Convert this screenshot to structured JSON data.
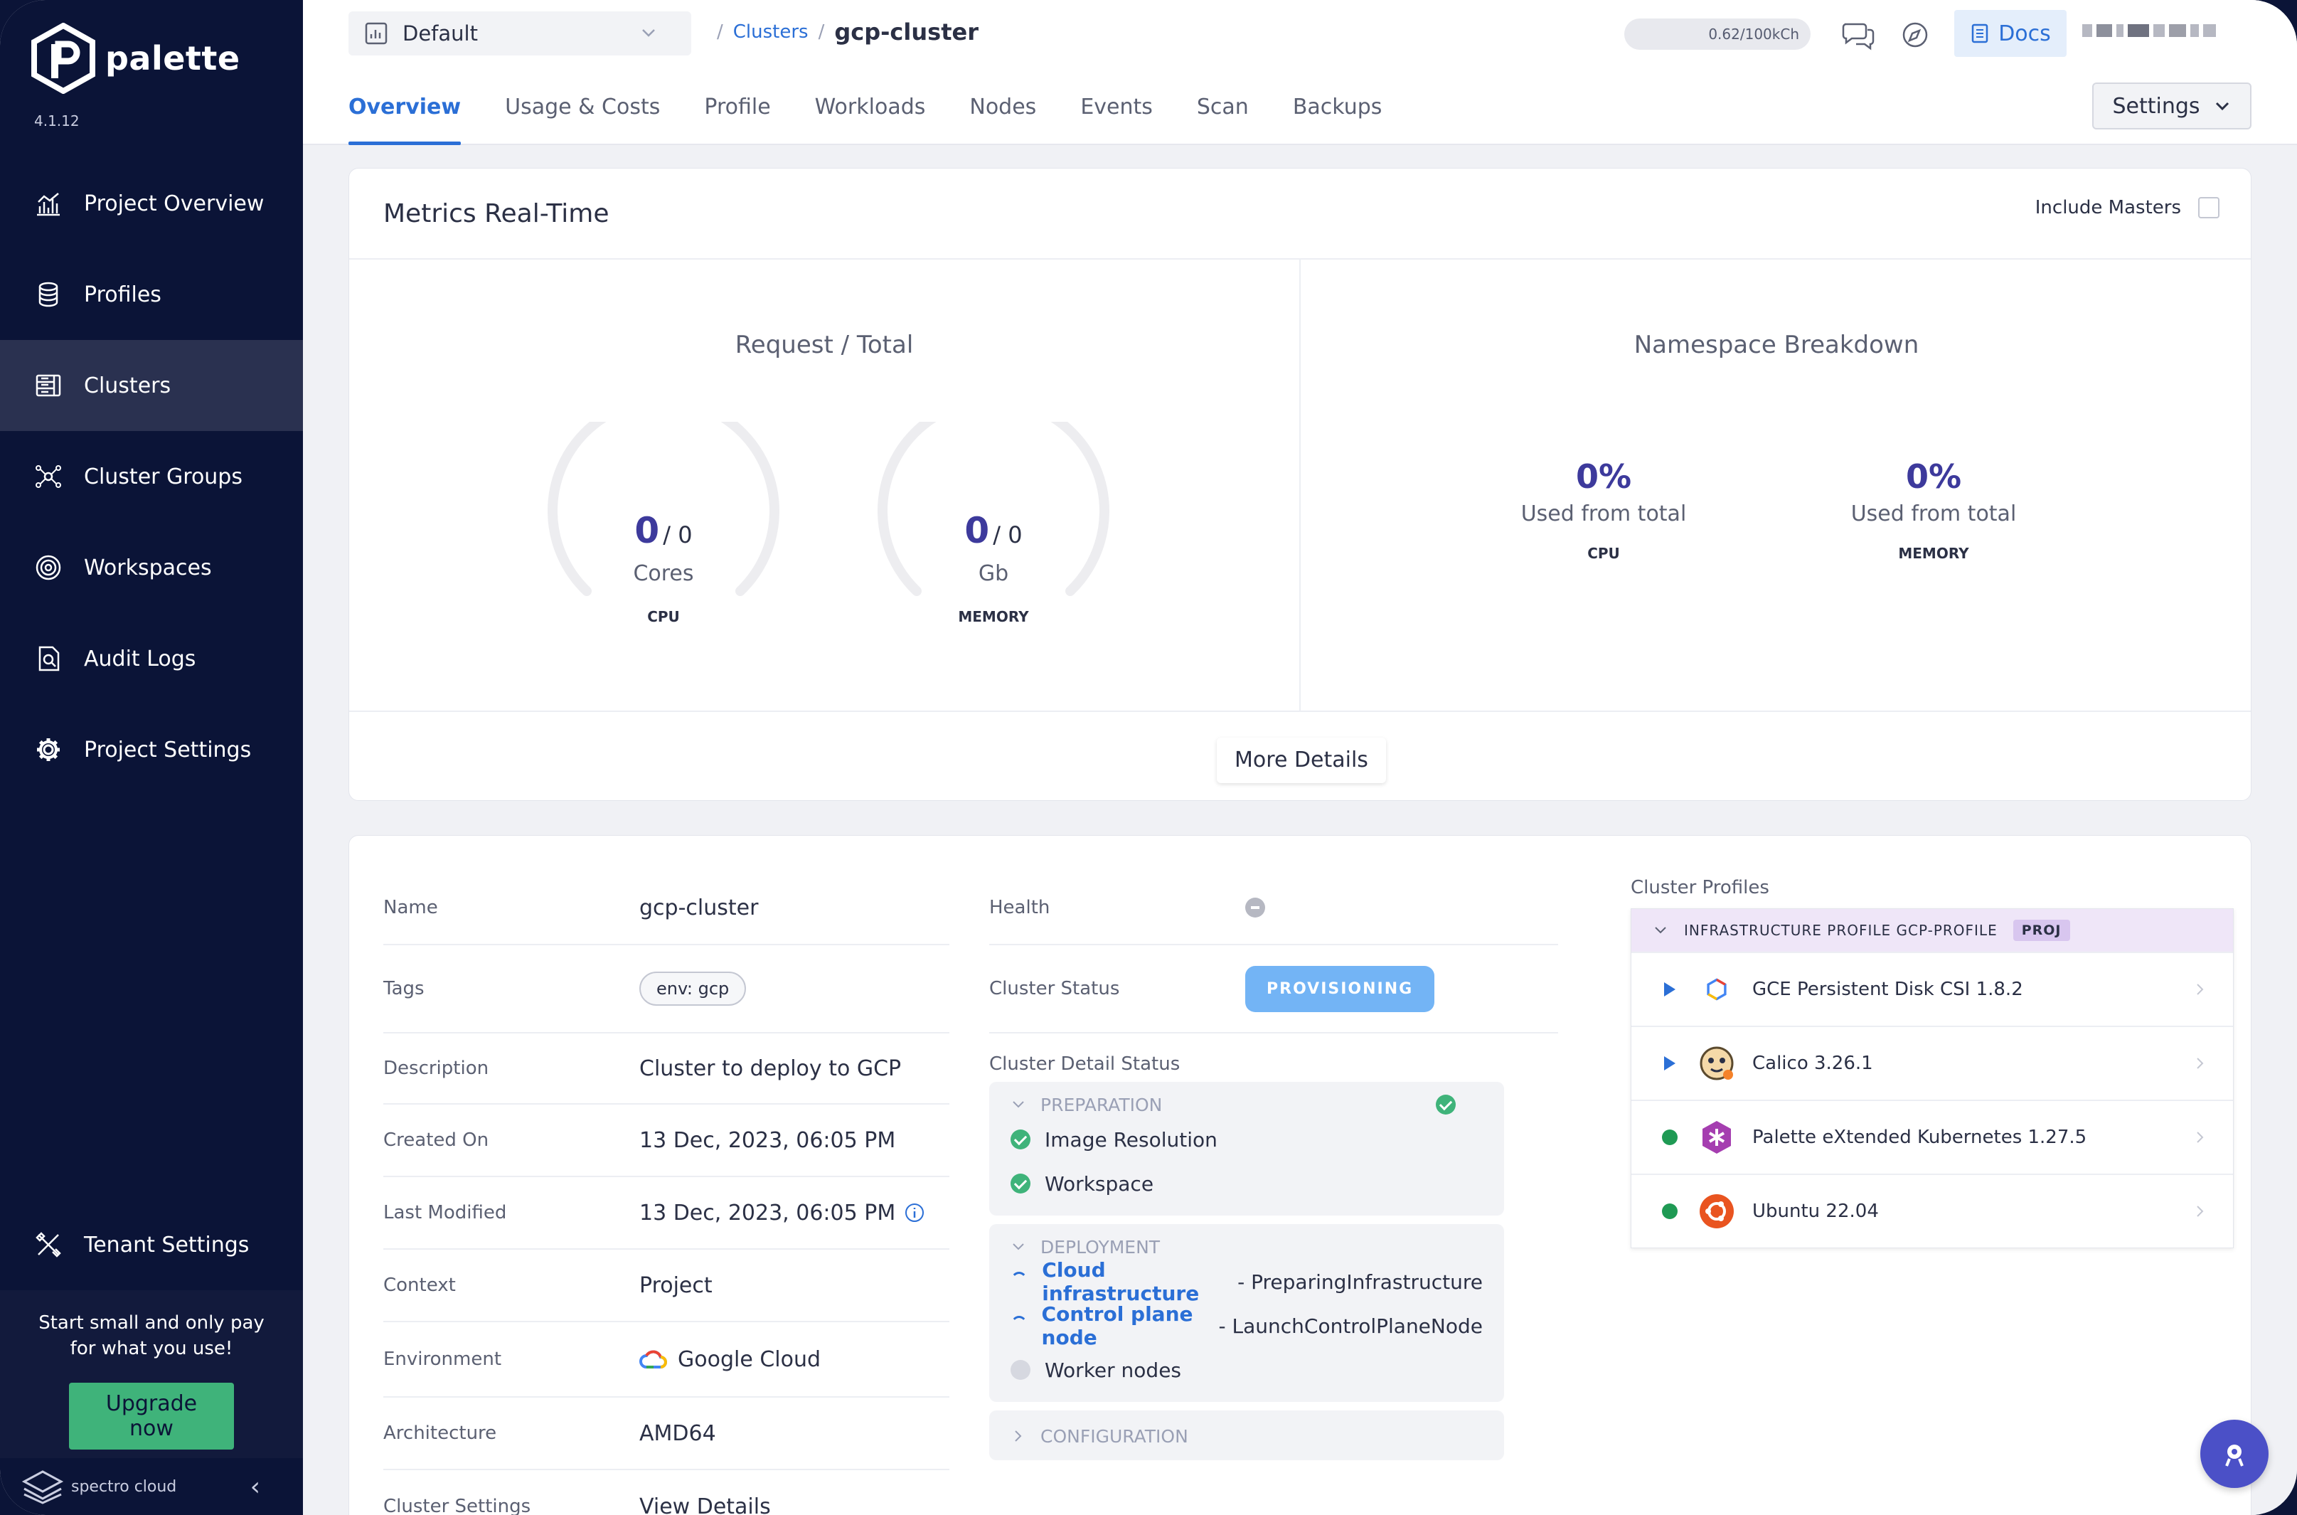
{
  "sidebar": {
    "brand": "palette",
    "version": "4.1.12",
    "items": [
      {
        "label": "Project Overview",
        "icon": "chart-icon"
      },
      {
        "label": "Profiles",
        "icon": "stack-icon"
      },
      {
        "label": "Clusters",
        "icon": "clusters-icon"
      },
      {
        "label": "Cluster Groups",
        "icon": "network-icon"
      },
      {
        "label": "Workspaces",
        "icon": "target-icon"
      },
      {
        "label": "Audit Logs",
        "icon": "audit-icon"
      },
      {
        "label": "Project Settings",
        "icon": "gear-icon"
      }
    ],
    "active_index": 2,
    "tenant_settings": "Tenant Settings",
    "promo_text": "Start small and only pay for what you use!",
    "upgrade_label": "Upgrade now",
    "footer_brand": "spectro cloud"
  },
  "header": {
    "project": "Default",
    "breadcrumb_sep": "/",
    "breadcrumb_link": "Clusters",
    "breadcrumb_current": "gcp-cluster",
    "usage": "0.62/100kCh",
    "docs_label": "Docs",
    "settings_label": "Settings",
    "tabs": [
      "Overview",
      "Usage & Costs",
      "Profile",
      "Workloads",
      "Nodes",
      "Events",
      "Scan",
      "Backups"
    ],
    "active_tab": 0
  },
  "metrics": {
    "title": "Metrics Real-Time",
    "include_masters": "Include Masters",
    "request_title": "Request / Total",
    "cpu": {
      "used": "0",
      "total": "/ 0",
      "unit": "Cores",
      "label": "CPU"
    },
    "memory": {
      "used": "0",
      "total": "/ 0",
      "unit": "Gb",
      "label": "MEMORY"
    },
    "namespace_title": "Namespace Breakdown",
    "ns_cpu": {
      "value": "0%",
      "sub": "Used from total",
      "label": "CPU"
    },
    "ns_memory": {
      "value": "0%",
      "sub": "Used from total",
      "label": "MEMORY"
    },
    "more_details": "More Details"
  },
  "details": {
    "name_k": "Name",
    "name_v": "gcp-cluster",
    "tags_k": "Tags",
    "tags_v": "env: gcp",
    "desc_k": "Description",
    "desc_v": "Cluster to deploy to GCP",
    "created_k": "Created On",
    "created_v": "13 Dec, 2023, 06:05 PM",
    "modified_k": "Last Modified",
    "modified_v": "13 Dec, 2023, 06:05 PM",
    "context_k": "Context",
    "context_v": "Project",
    "env_k": "Environment",
    "env_v": "Google Cloud",
    "arch_k": "Architecture",
    "arch_v": "AMD64",
    "settings_k": "Cluster Settings",
    "settings_v": "View Details",
    "health_k": "Health",
    "status_k": "Cluster Status",
    "status_v": "PROVISIONING",
    "detail_status_title": "Cluster Detail Status",
    "preparation": "PREPARATION",
    "prep_items": [
      "Image Resolution",
      "Workspace"
    ],
    "deployment": "DEPLOYMENT",
    "deploy_items": [
      {
        "link": "Cloud infrastructure",
        "rest": " - PreparingInfrastructure"
      },
      {
        "link": "Control plane node",
        "rest": " - LaunchControlPlaneNode"
      }
    ],
    "worker_nodes": "Worker nodes",
    "configuration": "CONFIGURATION"
  },
  "profiles": {
    "title": "Cluster Profiles",
    "header": "INFRASTRUCTURE PROFILE GCP-PROFILE",
    "badge": "PROJ",
    "layers": [
      {
        "name": "GCE Persistent Disk CSI 1.8.2",
        "icon": "gce-icon"
      },
      {
        "name": "Calico 3.26.1",
        "icon": "calico-icon"
      },
      {
        "name": "Palette eXtended Kubernetes 1.27.5",
        "icon": "kubernetes-icon"
      },
      {
        "name": "Ubuntu 22.04",
        "icon": "ubuntu-icon"
      }
    ]
  },
  "colors": {
    "accent": "#2b6fd6",
    "sidebar": "#0b1437",
    "success": "#3fb37a",
    "provisioning": "#73b4f5"
  }
}
